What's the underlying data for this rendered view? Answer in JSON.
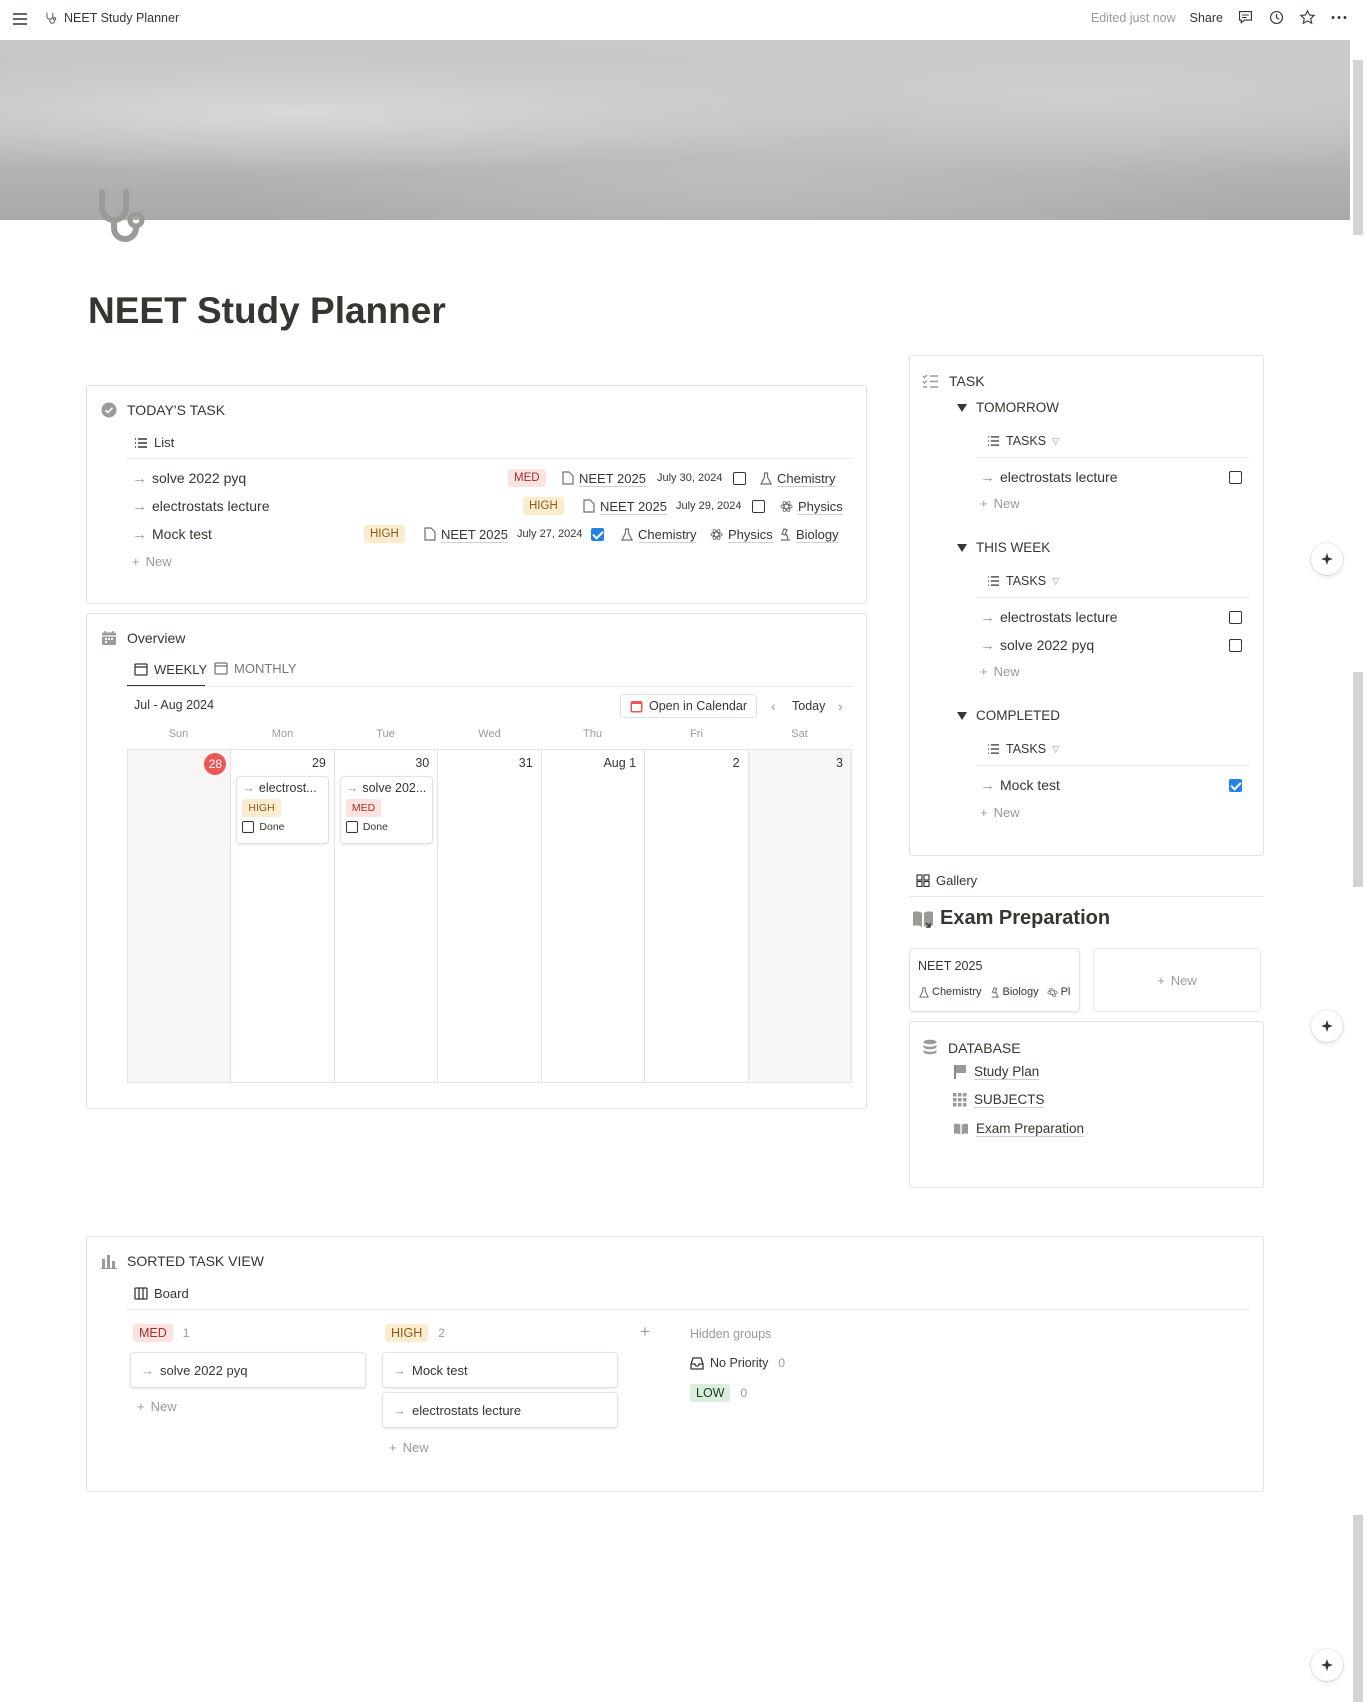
{
  "topbar": {
    "breadcrumb": "NEET Study Planner",
    "edited": "Edited just now",
    "share": "Share"
  },
  "page": {
    "title": "NEET Study Planner"
  },
  "todays_task": {
    "title": "TODAY'S TASK",
    "view": "List",
    "rows": [
      {
        "title": "solve 2022 pyq",
        "priority": "MED",
        "exam": "NEET 2025",
        "date": "July 30, 2024",
        "done": false,
        "subjects": [
          "Chemistry"
        ]
      },
      {
        "title": "electrostats lecture",
        "priority": "HIGH",
        "exam": "NEET 2025",
        "date": "July 29, 2024",
        "done": false,
        "subjects": [
          "Physics"
        ]
      },
      {
        "title": "Mock test",
        "priority": "HIGH",
        "exam": "NEET 2025",
        "date": "July 27, 2024",
        "done": true,
        "subjects": [
          "Chemistry",
          "Physics",
          "Biology"
        ]
      }
    ],
    "new_label": "New"
  },
  "overview": {
    "title": "Overview",
    "tabs": [
      "WEEKLY",
      "MONTHLY"
    ],
    "range": "Jul - Aug 2024",
    "open_calendar": "Open in Calendar",
    "today": "Today",
    "daynames": [
      "Sun",
      "Mon",
      "Tue",
      "Wed",
      "Thu",
      "Fri",
      "Sat"
    ],
    "days": [
      "28",
      "29",
      "30",
      "31",
      "Aug 1",
      "2",
      "3"
    ],
    "cards": [
      {
        "title": "electrost...",
        "priority": "HIGH",
        "done_label": "Done"
      },
      {
        "title": "solve 202...",
        "priority": "MED",
        "done_label": "Done"
      }
    ]
  },
  "task_panel": {
    "title": "TASK",
    "groups": [
      {
        "name": "TOMORROW",
        "tab": "TASKS",
        "items": [
          {
            "title": "electrostats lecture",
            "done": false
          }
        ],
        "new_label": "New"
      },
      {
        "name": "THIS WEEK",
        "tab": "TASKS",
        "items": [
          {
            "title": "electrostats lecture",
            "done": false
          },
          {
            "title": "solve 2022 pyq",
            "done": false
          }
        ],
        "new_label": "New"
      },
      {
        "name": "COMPLETED",
        "tab": "TASKS",
        "items": [
          {
            "title": "Mock test",
            "done": true
          }
        ],
        "new_label": "New"
      }
    ]
  },
  "gallery": {
    "view": "Gallery",
    "title": "Exam Preparation",
    "card_title": "NEET 2025",
    "card_tags": [
      "Chemistry",
      "Biology",
      "Pl"
    ],
    "new_label": "New"
  },
  "database": {
    "title": "DATABASE",
    "links": [
      "Study Plan",
      "SUBJECTS",
      "Exam Preparation"
    ]
  },
  "sorted": {
    "title": "SORTED TASK VIEW",
    "view": "Board",
    "columns": [
      {
        "label": "MED",
        "count": "1",
        "cards": [
          "solve 2022 pyq"
        ],
        "new_label": "New"
      },
      {
        "label": "HIGH",
        "count": "2",
        "cards": [
          "Mock test",
          "electrostats lecture"
        ],
        "new_label": "New"
      }
    ],
    "hidden_label": "Hidden groups",
    "hidden": [
      {
        "label": "No Priority",
        "count": "0"
      },
      {
        "label": "LOW",
        "count": "0"
      }
    ]
  },
  "colors": {
    "text": "#37352f",
    "muted": "#9b9a97",
    "accent": "#2383e2",
    "today": "#eb5757"
  }
}
